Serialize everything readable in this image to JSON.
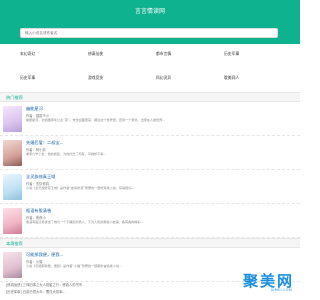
{
  "header": {
    "title": "言言情读网"
  },
  "search": {
    "placeholder": "输入小说名或作者名"
  },
  "nav": [
    "玄幻奇幻",
    "修真仙侠",
    "都市言情",
    "历史军事",
    "历史军事",
    "游戏竞技",
    "科幻灵异",
    "耽美同人"
  ],
  "hot": {
    "title": "热门推荐",
    "books": [
      {
        "title": "幽能星河",
        "author": "作者：猫腻不小",
        "desc": "幽能星河，北境国青年公主“蒸”。末世迎面而来，都在这个世界里，直到一个梦境，出现在人类世界..."
      },
      {
        "title": "先婚后爱：二叔宝...",
        "author": "作者：阿小妖",
        "desc": "季家六岁小女，他的娃娃，为他付出了所有，可她却不幸..."
      },
      {
        "title": "全灵族修真王域",
        "author": "作者：言情修真",
        "desc": "小说《全灵族修真王域》是作者“言情修真”所著的一部修真类小说，写得很好..."
      },
      {
        "title": "瓶语有股清香",
        "author": "作者：夜夜小",
        "desc": "瓶语有股清香讲述了她与一个不确定的男人，不为人知的那些小故事，各有各的精彩..."
      }
    ]
  },
  "recent": {
    "title": "本周推荐",
    "books": [
      {
        "title": "可能那我便，便我...",
        "author": "作者：小猫",
        "desc": "小说《可能那我便，便我》是作者“小猫”所著的一部都市言情类小说..."
      }
    ]
  },
  "updates": [
    "[修真仙侠] 三体旧事之大人说星之行：修真人的书写",
    "[历史军事] 日前已然大众：蜀汉大将军..."
  ],
  "watermark": {
    "text": "聚美网",
    "sub": "JUMEI.COM"
  }
}
